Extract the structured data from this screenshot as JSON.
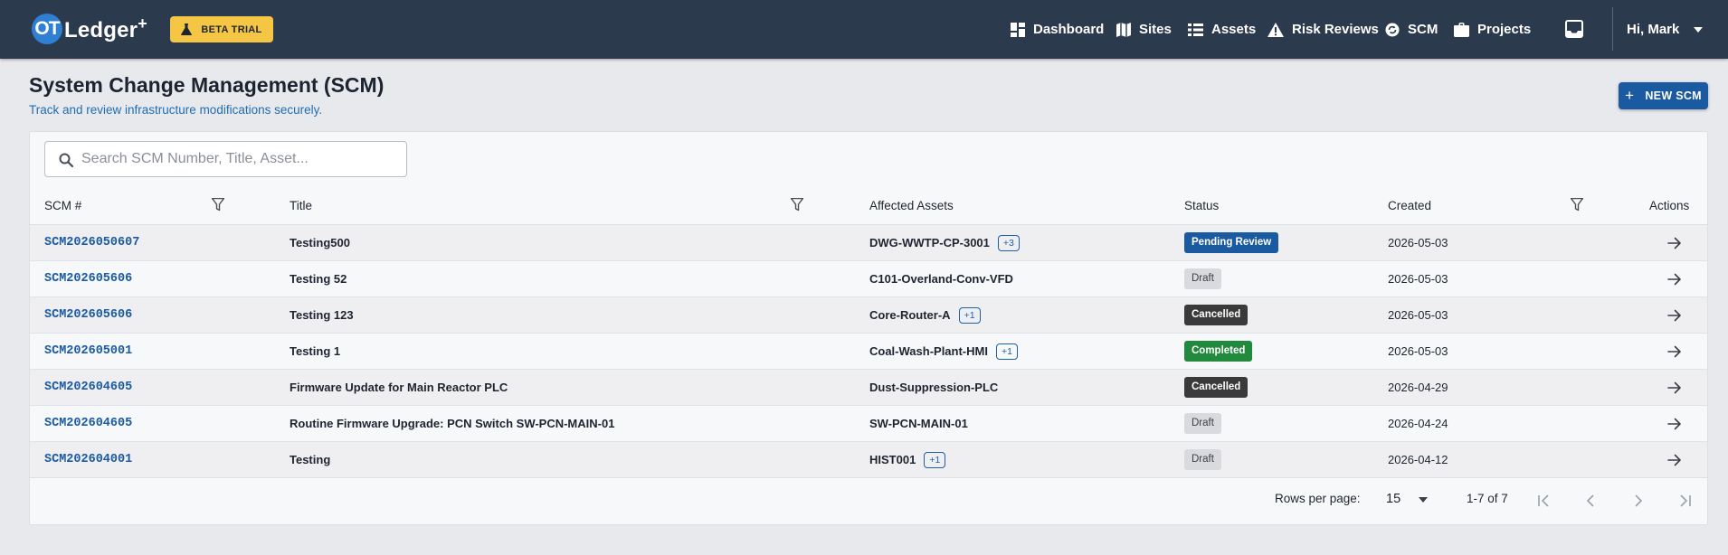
{
  "header": {
    "logo_mark": "OT",
    "logo_text": "Ledger",
    "logo_plus": "+",
    "beta_label": "BETA TRIAL",
    "nav": [
      {
        "label": "Dashboard",
        "icon": "dashboard-icon"
      },
      {
        "label": "Sites",
        "icon": "map-icon"
      },
      {
        "label": "Assets",
        "icon": "list-icon"
      },
      {
        "label": "Risk Reviews",
        "icon": "warning-icon"
      },
      {
        "label": "SCM",
        "icon": "scm-icon"
      },
      {
        "label": "Projects",
        "icon": "briefcase-icon"
      }
    ],
    "user_greeting": "Hi, Mark"
  },
  "page": {
    "title": "System Change Management (SCM)",
    "subtitle": "Track and review infrastructure modifications securely.",
    "new_button": "NEW SCM",
    "new_button_icon": "+"
  },
  "search": {
    "placeholder": "Search SCM Number, Title, Asset...",
    "value": ""
  },
  "table": {
    "columns": [
      "SCM #",
      "Title",
      "Affected Assets",
      "Status",
      "Created",
      "Actions"
    ],
    "rows": [
      {
        "scm": "SCM2026050607",
        "title": "Testing500",
        "asset": "DWG-WWTP-CP-3001",
        "more": "+3",
        "status": "Pending Review",
        "status_kind": "pending",
        "created": "2026-05-03"
      },
      {
        "scm": "SCM202605606",
        "title": "Testing 52",
        "asset": "C101-Overland-Conv-VFD",
        "more": "",
        "status": "Draft",
        "status_kind": "draft",
        "created": "2026-05-03"
      },
      {
        "scm": "SCM202605606",
        "title": "Testing 123",
        "asset": "Core-Router-A",
        "more": "+1",
        "status": "Cancelled",
        "status_kind": "cancelled",
        "created": "2026-05-03"
      },
      {
        "scm": "SCM202605001",
        "title": "Testing 1",
        "asset": "Coal-Wash-Plant-HMI",
        "more": "+1",
        "status": "Completed",
        "status_kind": "completed",
        "created": "2026-05-03"
      },
      {
        "scm": "SCM202604605",
        "title": "Firmware Update for Main Reactor PLC",
        "asset": "Dust-Suppression-PLC",
        "more": "",
        "status": "Cancelled",
        "status_kind": "cancelled",
        "created": "2026-04-29"
      },
      {
        "scm": "SCM202604605",
        "title": "Routine Firmware Upgrade: PCN Switch SW-PCN-MAIN-01",
        "asset": "SW-PCN-MAIN-01",
        "more": "",
        "status": "Draft",
        "status_kind": "draft",
        "created": "2026-04-24"
      },
      {
        "scm": "SCM202604001",
        "title": "Testing",
        "asset": "HIST001",
        "more": "+1",
        "status": "Draft",
        "status_kind": "draft",
        "created": "2026-04-12"
      }
    ]
  },
  "pagination": {
    "rows_per_page_label": "Rows per page:",
    "rows_per_page": "15",
    "range": "1-7 of 7"
  },
  "colors": {
    "topbar": "#2c3a4e",
    "accent": "#1a5aa1",
    "beta": "#f4c644",
    "completed": "#218a3c",
    "cancelled": "#3a3a3a",
    "draft": "#d9dadd"
  }
}
